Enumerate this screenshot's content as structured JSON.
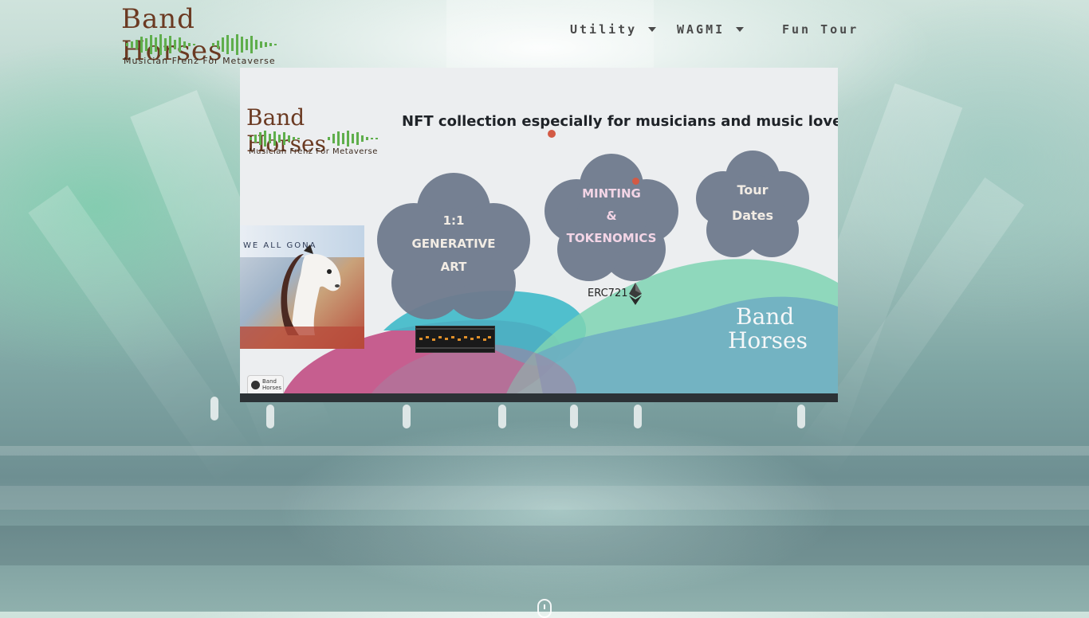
{
  "header": {
    "logo": {
      "title": "Band Horses",
      "subtitle": "Musician Frenz For Metaverse"
    },
    "nav": [
      {
        "label": "Utility",
        "has_dropdown": true
      },
      {
        "label": "WAGMI",
        "has_dropdown": true
      },
      {
        "label": "Fun Tour",
        "has_dropdown": false
      }
    ]
  },
  "banner": {
    "logo": {
      "title": "Band Horses",
      "subtitle": "Musician Frenz For Metaverse"
    },
    "headline": "NFT collection especially for musicians and music lovers.",
    "album_text": "WE ALL GONA",
    "features": [
      {
        "lines": [
          "1:1",
          "GENERATIVE",
          "ART"
        ]
      },
      {
        "lines": [
          "MINTING",
          "&",
          "TOKENOMICS"
        ]
      },
      {
        "lines": [
          "Tour",
          "Dates"
        ]
      }
    ],
    "standard_label": "ERC721",
    "watermark": {
      "line1": "Band",
      "line2": "Horses"
    },
    "badge": {
      "line1": "Band",
      "line2": "Horses"
    }
  },
  "colors": {
    "logo_brown": "#6b3a22",
    "wave_green": "#5fae4c",
    "nav_text": "#4a4a4a",
    "flower_fill": "#6f7b8e",
    "banner_bg": "#eceef0",
    "wave_pink": "#c0447e",
    "wave_teal": "#3fb9c9",
    "wave_mint": "#7fd3b3"
  },
  "icons": [
    "chevron-down-icon",
    "ethereum-icon",
    "vinyl-disc-icon",
    "scroll-down-icon"
  ]
}
